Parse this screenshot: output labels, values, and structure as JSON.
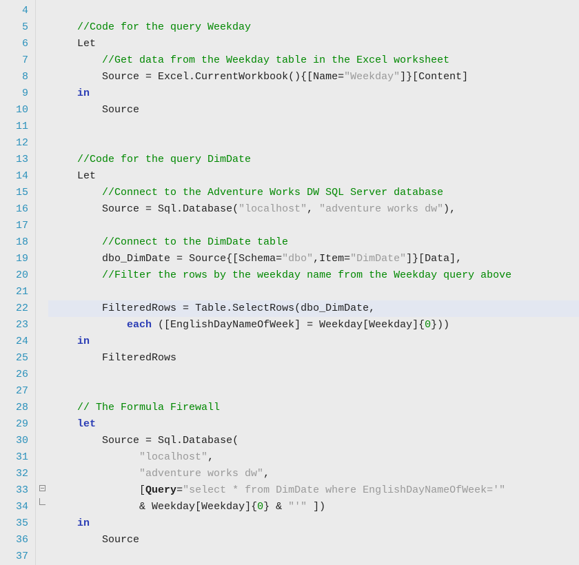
{
  "editor": {
    "first_line_no": 4,
    "last_line_no": 37,
    "highlighted_line": 22,
    "fold_region": {
      "start": 33,
      "end": 34
    },
    "cursor_line": 22,
    "cursor_col_after": "dbo_Di",
    "tab_width": 4,
    "lines": [
      {
        "n": 4,
        "tokens": []
      },
      {
        "n": 5,
        "tokens": [
          [
            "    ",
            ""
          ],
          [
            "//Code for the query Weekday",
            "c"
          ]
        ]
      },
      {
        "n": 6,
        "tokens": [
          [
            "    ",
            ""
          ],
          [
            "Let",
            "id"
          ]
        ]
      },
      {
        "n": 7,
        "tokens": [
          [
            "        ",
            ""
          ],
          [
            "//Get data from the Weekday table in the Excel worksheet",
            "c"
          ]
        ]
      },
      {
        "n": 8,
        "tokens": [
          [
            "        ",
            ""
          ],
          [
            "Source ",
            "id"
          ],
          [
            "=",
            "op"
          ],
          [
            " Excel.CurrentWorkbook(){[Name=",
            "id"
          ],
          [
            "\"Weekday\"",
            "s"
          ],
          [
            "]}[Content]",
            "id"
          ]
        ]
      },
      {
        "n": 9,
        "tokens": [
          [
            "    ",
            ""
          ],
          [
            "in",
            "kw"
          ]
        ]
      },
      {
        "n": 10,
        "tokens": [
          [
            "        ",
            ""
          ],
          [
            "Source",
            "id"
          ]
        ]
      },
      {
        "n": 11,
        "tokens": []
      },
      {
        "n": 12,
        "tokens": []
      },
      {
        "n": 13,
        "tokens": [
          [
            "    ",
            ""
          ],
          [
            "//Code for the query DimDate",
            "c"
          ]
        ]
      },
      {
        "n": 14,
        "tokens": [
          [
            "    ",
            ""
          ],
          [
            "Let",
            "id"
          ]
        ]
      },
      {
        "n": 15,
        "tokens": [
          [
            "        ",
            ""
          ],
          [
            "//Connect to the Adventure Works DW SQL Server database",
            "c"
          ]
        ]
      },
      {
        "n": 16,
        "tokens": [
          [
            "        ",
            ""
          ],
          [
            "Source ",
            "id"
          ],
          [
            "=",
            "op"
          ],
          [
            " Sql.Database(",
            "id"
          ],
          [
            "\"localhost\"",
            "s"
          ],
          [
            ", ",
            "id"
          ],
          [
            "\"adventure works dw\"",
            "s"
          ],
          [
            "),",
            "id"
          ]
        ]
      },
      {
        "n": 17,
        "tokens": []
      },
      {
        "n": 18,
        "tokens": [
          [
            "        ",
            ""
          ],
          [
            "//Connect to the DimDate table",
            "c"
          ]
        ]
      },
      {
        "n": 19,
        "tokens": [
          [
            "        ",
            ""
          ],
          [
            "dbo_DimDate ",
            "id"
          ],
          [
            "=",
            "op"
          ],
          [
            " Source{[Schema=",
            "id"
          ],
          [
            "\"dbo\"",
            "s"
          ],
          [
            ",Item=",
            "id"
          ],
          [
            "\"DimDate\"",
            "s"
          ],
          [
            "]}[Data],",
            "id"
          ]
        ]
      },
      {
        "n": 20,
        "tokens": [
          [
            "        ",
            ""
          ],
          [
            "//Filter the rows by the weekday name from the Weekday query above",
            "c"
          ]
        ]
      },
      {
        "n": 21,
        "tokens": []
      },
      {
        "n": 22,
        "tokens": [
          [
            "        ",
            ""
          ],
          [
            "FilteredRows ",
            "id"
          ],
          [
            "=",
            "op"
          ],
          [
            " Table.SelectRows(dbo_DimDate,",
            "id"
          ]
        ]
      },
      {
        "n": 23,
        "tokens": [
          [
            "            ",
            ""
          ],
          [
            "each",
            "kw"
          ],
          [
            " ([EnglishDayNameOfWeek] ",
            "id"
          ],
          [
            "=",
            "op"
          ],
          [
            " Weekday[Weekday]{",
            "id"
          ],
          [
            "0",
            "num"
          ],
          [
            "}))",
            "id"
          ]
        ]
      },
      {
        "n": 24,
        "tokens": [
          [
            "    ",
            ""
          ],
          [
            "in",
            "kw"
          ]
        ]
      },
      {
        "n": 25,
        "tokens": [
          [
            "        ",
            ""
          ],
          [
            "FilteredRows",
            "id"
          ]
        ]
      },
      {
        "n": 26,
        "tokens": []
      },
      {
        "n": 27,
        "tokens": []
      },
      {
        "n": 28,
        "tokens": [
          [
            "    ",
            ""
          ],
          [
            "// The Formula Firewall",
            "c"
          ]
        ]
      },
      {
        "n": 29,
        "tokens": [
          [
            "    ",
            ""
          ],
          [
            "let",
            "kw"
          ]
        ]
      },
      {
        "n": 30,
        "tokens": [
          [
            "        ",
            ""
          ],
          [
            "Source ",
            "id"
          ],
          [
            "=",
            "op"
          ],
          [
            " Sql.Database(",
            "id"
          ]
        ]
      },
      {
        "n": 31,
        "tokens": [
          [
            "              ",
            ""
          ],
          [
            "\"localhost\"",
            "s"
          ],
          [
            ",",
            "id"
          ]
        ]
      },
      {
        "n": 32,
        "tokens": [
          [
            "              ",
            ""
          ],
          [
            "\"adventure works dw\"",
            "s"
          ],
          [
            ",",
            "id"
          ]
        ]
      },
      {
        "n": 33,
        "tokens": [
          [
            "              ",
            ""
          ],
          [
            "[",
            "id"
          ],
          [
            "Query",
            "fb"
          ],
          [
            "=",
            "op"
          ],
          [
            "\"select * from DimDate where EnglishDayNameOfWeek='\"",
            "s"
          ]
        ]
      },
      {
        "n": 34,
        "tokens": [
          [
            "              ",
            ""
          ],
          [
            "&",
            "op"
          ],
          [
            " Weekday[Weekday]{",
            "id"
          ],
          [
            "0",
            "num"
          ],
          [
            "} ",
            "id"
          ],
          [
            "&",
            "op"
          ],
          [
            " ",
            "id"
          ],
          [
            "\"'\"",
            "s"
          ],
          [
            " ])",
            "id"
          ]
        ]
      },
      {
        "n": 35,
        "tokens": [
          [
            "    ",
            ""
          ],
          [
            "in",
            "kw"
          ]
        ]
      },
      {
        "n": 36,
        "tokens": [
          [
            "        ",
            ""
          ],
          [
            "Source",
            "id"
          ]
        ]
      },
      {
        "n": 37,
        "tokens": []
      }
    ]
  }
}
